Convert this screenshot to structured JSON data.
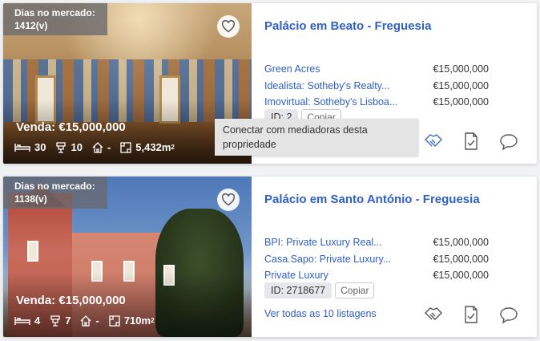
{
  "properties": [
    {
      "days_on_market": "Dias no mercado: 1412(v)",
      "price_overlay": "Venda: €15,000,000",
      "bedrooms": "30",
      "bathrooms": "10",
      "land": "-",
      "area": "5,432m",
      "area_sup": "2",
      "title": "Palácio em Beato - Freguesia",
      "listings": [
        {
          "agent": "Green Acres",
          "price": "€15,000,000"
        },
        {
          "agent": "Idealista: Sotheby's Realty...",
          "price": "€15,000,000"
        },
        {
          "agent": "Imovirtual: Sotheby's Lisboa...",
          "price": "€15,000,000"
        }
      ],
      "id_label": "ID: 2",
      "copy_label": "Copiar"
    },
    {
      "days_on_market": "Dias no mercado: 1138(v)",
      "price_overlay": "Venda: €15,000,000",
      "bedrooms": "4",
      "bathrooms": "7",
      "land": "-",
      "area": "710m",
      "area_sup": "2",
      "title": "Palácio em Santo António - Freguesia",
      "listings": [
        {
          "agent": "BPI: Private Luxury Real...",
          "price": "€15,000,000"
        },
        {
          "agent": "Casa.Sapo: Private Luxury...",
          "price": "€15,000,000"
        },
        {
          "agent": "Private Luxury",
          "price": "€15,000,000"
        }
      ],
      "id_label": "ID: 2718677",
      "copy_label": "Copiar",
      "see_all": "Ver todas as 10 listagens"
    }
  ],
  "tooltip": "Conectar com mediadoras desta propriedade",
  "icons": {
    "favorite": "heart-icon",
    "bed": "bed-icon",
    "bath": "bath-icon",
    "land": "land-icon",
    "area": "area-icon",
    "connect": "handshake-icon",
    "document": "document-check-icon",
    "message": "chat-bubble-icon"
  },
  "colors": {
    "link": "#2f5fc8",
    "tooltip_bg": "#e4e4e4",
    "badge_bg": "#69696e"
  }
}
